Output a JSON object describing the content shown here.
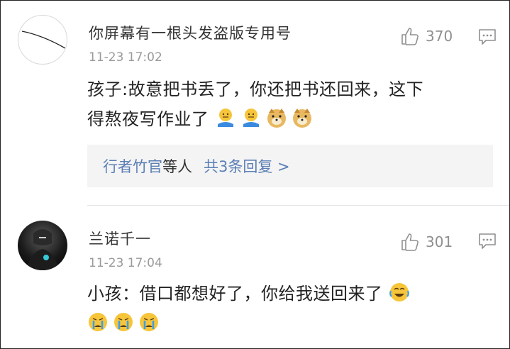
{
  "comments": [
    {
      "username": "你屏幕有一根头发盗版专用号",
      "time": "11-23 17:02",
      "likes": "370",
      "text_line1": "孩子:故意把书丢了，你还把书还回来，这下",
      "text_line2": "得熬夜写作业了",
      "emojis": [
        "shrug-emoji",
        "shrug-emoji",
        "doge-emoji",
        "doge-emoji"
      ],
      "reply_summary": {
        "users": "行者竹官",
        "suffix": "等人",
        "count_text": "共3条回复 >"
      }
    },
    {
      "username": "兰诺千一",
      "time": "11-23 17:04",
      "likes": "301",
      "text_line1": "小孩：借口都想好了，你给我送回来了",
      "emojis": [
        "laugh-cry-emoji",
        "crying-emoji",
        "crying-emoji",
        "crying-emoji"
      ]
    }
  ]
}
